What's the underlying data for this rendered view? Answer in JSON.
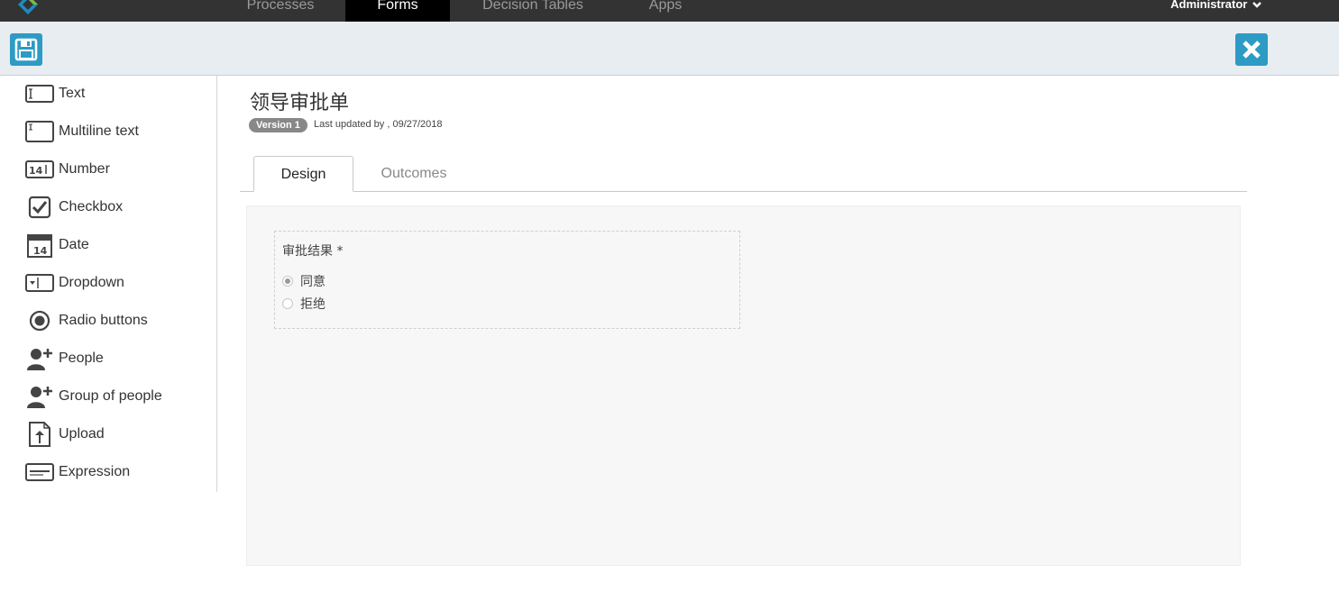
{
  "nav": {
    "tabs": [
      "Processes",
      "Forms",
      "Decision Tables",
      "Apps"
    ],
    "active_tab": "Forms",
    "user": "Administrator"
  },
  "toolbar": {
    "save_icon": "floppy-disk-icon",
    "close_icon": "close-x-icon",
    "accent_color": "#2d9bc4"
  },
  "palette": {
    "items": [
      {
        "label": "Text",
        "icon": "text-field-icon"
      },
      {
        "label": "Multiline text",
        "icon": "multiline-text-icon"
      },
      {
        "label": "Number",
        "icon": "number-icon"
      },
      {
        "label": "Checkbox",
        "icon": "checkbox-icon"
      },
      {
        "label": "Date",
        "icon": "calendar-icon"
      },
      {
        "label": "Dropdown",
        "icon": "dropdown-icon"
      },
      {
        "label": "Radio buttons",
        "icon": "radio-icon"
      },
      {
        "label": "People",
        "icon": "person-add-icon"
      },
      {
        "label": "Group of people",
        "icon": "group-add-icon"
      },
      {
        "label": "Upload",
        "icon": "upload-icon"
      },
      {
        "label": "Expression",
        "icon": "expression-icon"
      }
    ]
  },
  "form": {
    "title": "领导审批单",
    "version": "Version 1",
    "updated": "Last updated by , 09/27/2018"
  },
  "tabs": {
    "design": "Design",
    "outcomes": "Outcomes"
  },
  "field": {
    "label": "审批结果 *",
    "options": [
      {
        "label": "同意",
        "checked": true
      },
      {
        "label": "拒绝",
        "checked": false
      }
    ]
  }
}
